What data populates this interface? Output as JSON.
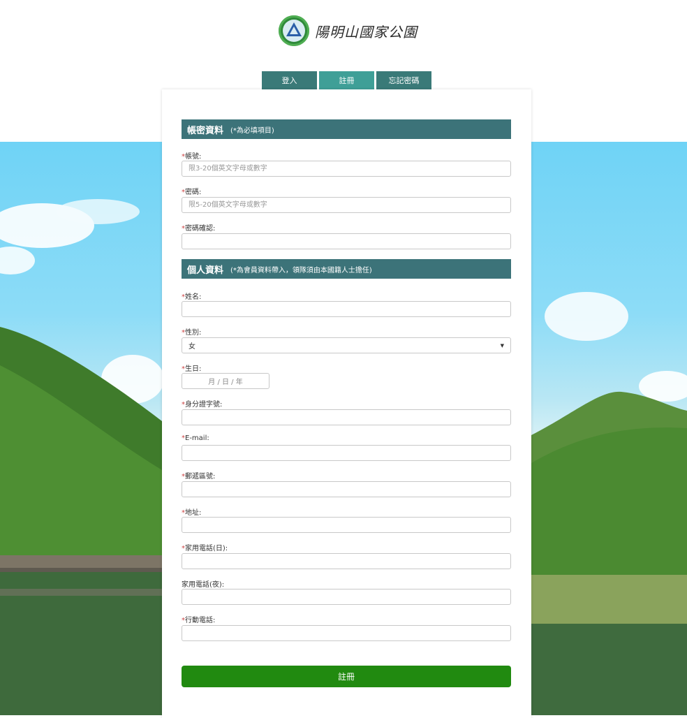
{
  "logo": {
    "text": "陽明山國家公園"
  },
  "tabs": [
    {
      "label": "登入"
    },
    {
      "label": "註冊"
    },
    {
      "label": "忘記密碼"
    }
  ],
  "account_section": {
    "title": "帳密資料",
    "note": "(*為必填項目)"
  },
  "personal_section": {
    "title": "個人資料",
    "note": "(*為會員資料帶入，領隊須由本國籍人士擔任)"
  },
  "fields": {
    "account": {
      "label": "帳號:",
      "placeholder": "限3-20個英文字母或數字"
    },
    "password": {
      "label": "密碼:",
      "placeholder": "限5-20個英文字母或數字"
    },
    "password_confirm": {
      "label": "密碼確認:"
    },
    "name": {
      "label": "姓名:"
    },
    "gender": {
      "label": "性別:",
      "value": "女"
    },
    "birthday": {
      "label": "生日:",
      "placeholder": "月 / 日 / 年"
    },
    "id_number": {
      "label": "身分證字號:"
    },
    "email": {
      "label": "E-mail:"
    },
    "postal": {
      "label": "郵遞區號:"
    },
    "address": {
      "label": "地址:"
    },
    "home_phone_day": {
      "label": "家用電話(日):"
    },
    "home_phone_night": {
      "label": "家用電話(夜):"
    },
    "mobile": {
      "label": "行動電話:"
    }
  },
  "required_mark": "*",
  "submit": {
    "label": "註冊"
  },
  "colors": {
    "tab": "#3a7a78",
    "tab_active": "#3f9f97",
    "section": "#3c7379",
    "submit": "#218a10"
  }
}
